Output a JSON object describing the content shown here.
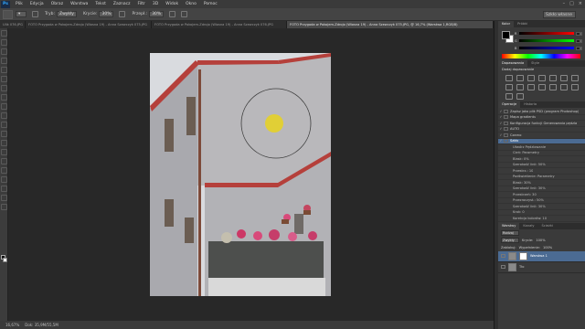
{
  "menu": {
    "app_icon": "Ps",
    "items": [
      "Plik",
      "Edycja",
      "Obraz",
      "Warstwa",
      "Tekst",
      "Zaznacz",
      "Filtr",
      "3D",
      "Widok",
      "Okno",
      "Pomoc"
    ]
  },
  "options": {
    "mode_label": "Tryb:",
    "mode_value": "Zwykły",
    "opacity_label": "Krycie:",
    "opacity_value": "30%",
    "flow_label": "Przepł.:",
    "flow_value": "30%",
    "workspace": "Szkło własne"
  },
  "tabs": [
    {
      "label": "Ulik 076.JPG",
      "active": false
    },
    {
      "label": "FOTO Przygoda w Pokojem-Zdrojo (Wiosna 19) - Anna Szewczyk 075.JPG",
      "active": false
    },
    {
      "label": "FOTO Przygoda w Pokojem-Zdrojo (Wiosna 19) - Anna Szewczyk 076.JPG",
      "active": false
    },
    {
      "label": "FOTO Przygoda w Pokojem-Zdrojo (Wiosna 19) - Anna Szewczyk 075.JPG, @ 16,7% (Warstwa 1,RGB/8)",
      "active": true
    }
  ],
  "status": {
    "zoom": "16,67%",
    "doc": "Dok: 35,9M/55,5M"
  },
  "colors": {
    "accent_select": "#4b6b93",
    "panel": "#3a3a3a",
    "yellow_brush": "#e8d21e",
    "wall_red": "#b5403b"
  },
  "color_panel": {
    "tabs": [
      "Kolor",
      "Próbki"
    ],
    "rows": [
      {
        "ch": "R",
        "value": "0",
        "gradient": "linear-gradient(to right,#000,#f00)"
      },
      {
        "ch": "G",
        "value": "0",
        "gradient": "linear-gradient(to right,#000,#0f0)"
      },
      {
        "ch": "B",
        "value": "0",
        "gradient": "linear-gradient(to right,#000,#00f)"
      }
    ]
  },
  "adjustments": {
    "tabs": [
      "Dopasowania",
      "Style"
    ],
    "title": "Dodaj dopasowanie"
  },
  "history": {
    "tabs": [
      "Operacje",
      "Historia"
    ],
    "items": [
      {
        "text": "Zapisz jako plik PSD (program Photoshop)",
        "sub": false,
        "selected": false
      },
      {
        "text": "Mapa gradientu",
        "sub": false,
        "selected": false
      },
      {
        "text": "Konfiguracja funkcji Generowania pędzla",
        "sub": false,
        "selected": false
      },
      {
        "text": "AUTO",
        "sub": false,
        "selected": false
      },
      {
        "text": "Czarno",
        "sub": false,
        "selected": false
      },
      {
        "text": "Szkło",
        "sub": false,
        "selected": true
      },
      {
        "text": "Utwórz Pędzlowanie",
        "sub": true,
        "selected": false
      },
      {
        "text": "Cień: Parametry",
        "sub": true,
        "selected": false
      },
      {
        "text": "Blask: 0%",
        "sub": true,
        "selected": false
      },
      {
        "text": "Szerokość linii: 50%",
        "sub": true,
        "selected": false
      },
      {
        "text": "Przestrz.: 10",
        "sub": true,
        "selected": false
      },
      {
        "text": "Podświetlenie: Parametry",
        "sub": true,
        "selected": false
      },
      {
        "text": "Blask: 30%",
        "sub": true,
        "selected": false
      },
      {
        "text": "Szerokość linii: 30%",
        "sub": true,
        "selected": false
      },
      {
        "text": "Przestrzeń: 30",
        "sub": true,
        "selected": false
      },
      {
        "text": "Przezroczyst.: 50%",
        "sub": true,
        "selected": false
      },
      {
        "text": "Szerokość linii: 30%",
        "sub": true,
        "selected": false
      },
      {
        "text": "Krok: 0",
        "sub": true,
        "selected": false
      },
      {
        "text": "Korekcja kolorów: 10",
        "sub": true,
        "selected": false
      }
    ]
  },
  "layers": {
    "tabs": [
      "Warstwy",
      "Kanały",
      "Ścieżki"
    ],
    "kind": "Rodzaj",
    "blend": "Zwykły",
    "opacity_label": "Krycie:",
    "opacity": "100%",
    "lock_label": "Zablokuj:",
    "fill_label": "Wypełnienie:",
    "fill": "100%",
    "items": [
      {
        "name": "Warstwa 1",
        "active": true
      },
      {
        "name": "Tło",
        "active": false
      }
    ]
  }
}
